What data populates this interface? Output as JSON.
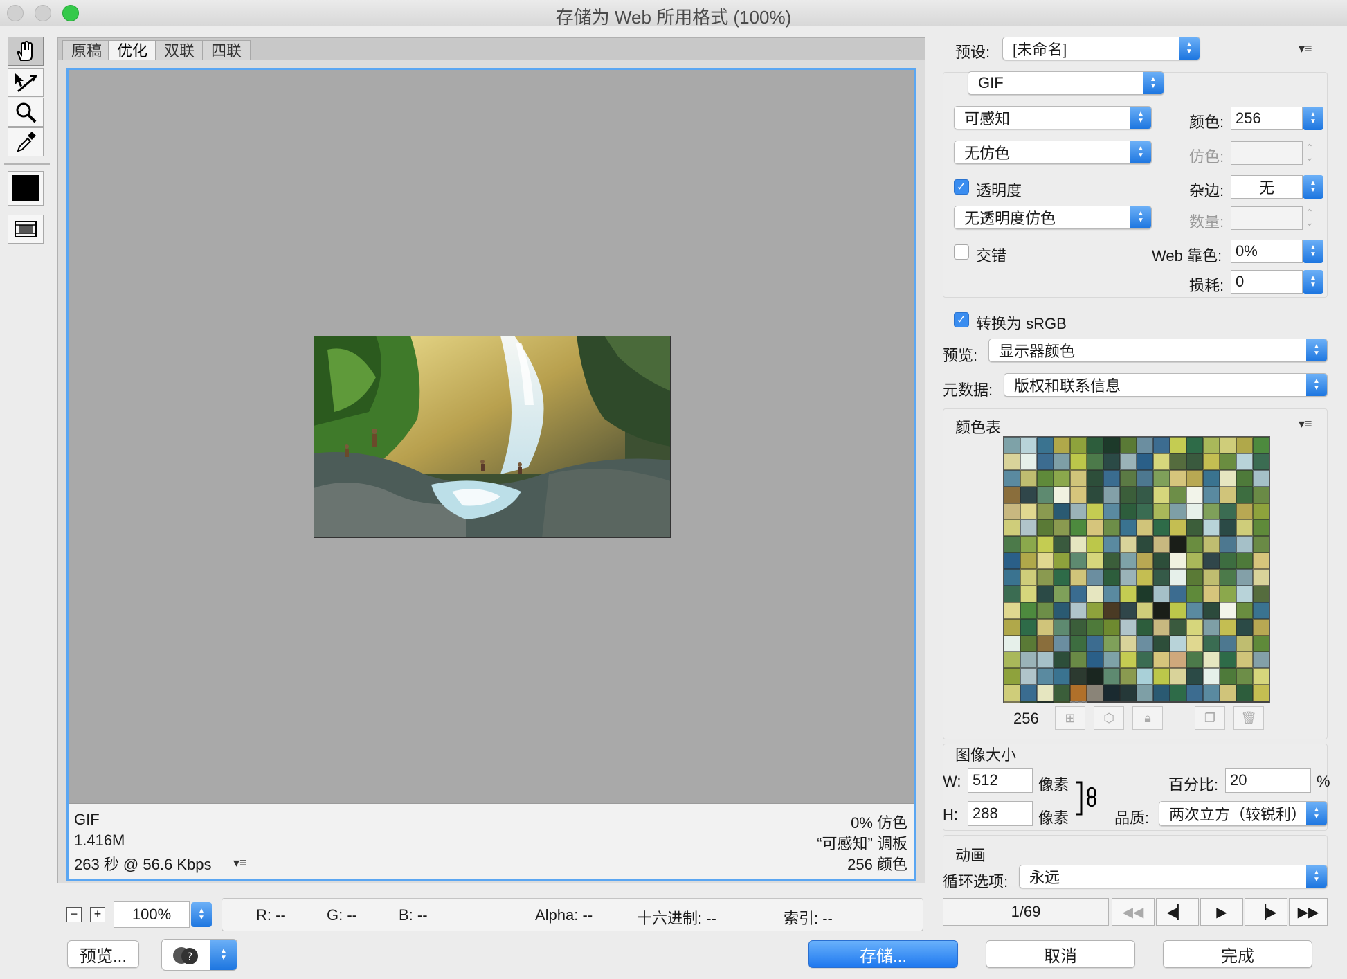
{
  "window": {
    "title": "存储为 Web 所用格式 (100%)"
  },
  "tabs": [
    "原稿",
    "优化",
    "双联",
    "四联"
  ],
  "active_tab": "优化",
  "preview_info": {
    "format": "GIF",
    "size": "1.416M",
    "time": "263 秒 @ 56.6 Kbps",
    "dither": "0% 仿色",
    "palette": "“可感知” 调板",
    "colors": "256 颜色"
  },
  "statusbar": {
    "zoom": "100%",
    "r": "R: --",
    "g": "G: --",
    "b": "B: --",
    "alpha": "Alpha: --",
    "hex": "十六进制: --",
    "index": "索引: --"
  },
  "buttons": {
    "preview": "预览...",
    "save": "存储...",
    "cancel": "取消",
    "done": "完成"
  },
  "settings": {
    "preset_label": "预设:",
    "preset_value": "[未命名]",
    "format": "GIF",
    "reduction": "可感知",
    "dither_algo": "无仿色",
    "colors_label": "颜色:",
    "colors_value": "256",
    "dither_label": "仿色:",
    "transparency_label": "透明度",
    "transparency_checked": true,
    "matte_label": "杂边:",
    "matte_value": "无",
    "transparency_dither": "无透明度仿色",
    "amount_label": "数量:",
    "interlaced_label": "交错",
    "interlaced_checked": false,
    "web_snap_label": "Web 靠色:",
    "web_snap_value": "0%",
    "lossy_label": "损耗:",
    "lossy_value": "0",
    "srgb_label": "转换为 sRGB",
    "srgb_checked": true,
    "preview_label": "预览:",
    "preview_value": "显示器颜色",
    "metadata_label": "元数据:",
    "metadata_value": "版权和联系信息"
  },
  "color_table": {
    "title": "颜色表",
    "count": "256",
    "colors": [
      "#7ea2a8",
      "#b8d3d9",
      "#3a7390",
      "#b0a84a",
      "#8ea23c",
      "#2d5d3c",
      "#1d3a2a",
      "#5a7a36",
      "#6b8ea0",
      "#3c6c90",
      "#c4cc52",
      "#2e6b48",
      "#a9b85a",
      "#cfcd7a",
      "#b0a84a",
      "#4d8a3e",
      "#d9d39a",
      "#e6f0ea",
      "#3c6c90",
      "#7e9fa6",
      "#bcc74a",
      "#4c7a4a",
      "#2b4a46",
      "#9ab3b8",
      "#2a5f88",
      "#d6d67c",
      "#556c3e",
      "#3a5a3e",
      "#c4be52",
      "#6a8d40",
      "#b8d3d9",
      "#3b6c52",
      "#5a8aa0",
      "#bfbd70",
      "#5f8a3a",
      "#8ba84c",
      "#d0c47a",
      "#2d4e3a",
      "#3a6c90",
      "#5b7a44",
      "#4d7890",
      "#7fa05a",
      "#d6c57c",
      "#b8a853",
      "#3a7390",
      "#e6e6c0",
      "#4e7a3a",
      "#a5c0c8",
      "#8a6e3c",
      "#30464a",
      "#5e8a70",
      "#f0f2e0",
      "#d6c57c",
      "#2c4a3c",
      "#83a0a8",
      "#3b5e3a",
      "#355a48",
      "#d6d67c",
      "#6d8e48",
      "#f2f4ea",
      "#5a8aa0",
      "#d0c47a",
      "#3d6d40",
      "#6a8a46",
      "#c8b880",
      "#e0d890",
      "#8a9a50",
      "#2a5a72",
      "#9ab3b8",
      "#c4cc52",
      "#5a8aa0",
      "#2d5d3c",
      "#3a6c52",
      "#a9b85a",
      "#7e9fa6",
      "#e6f0ea",
      "#7fa05a",
      "#3b6c52",
      "#b8a853",
      "#8ea23c",
      "#cfcd7a",
      "#b0c4ca",
      "#5a7a36",
      "#8a9a50",
      "#4d8a3e",
      "#d6c57c",
      "#6d8e48",
      "#3a7390",
      "#d0c47a",
      "#2e6b48",
      "#c4be52",
      "#3c5e3a",
      "#b8d3d9",
      "#2b4a46",
      "#cfcd7a",
      "#5f8a3a",
      "#4c7a4a",
      "#8ba84c",
      "#c4cc52",
      "#3a5a3e",
      "#e6e6c0",
      "#bcc74a",
      "#5a8aa0",
      "#d9d39a",
      "#2c4a3c",
      "#c8b880",
      "#1a1e18",
      "#6a8d40",
      "#bfbd70",
      "#4d7890",
      "#a5c0c8",
      "#6a8a46",
      "#2a5f88",
      "#b0a84a",
      "#e0d890",
      "#8ea23c",
      "#5e8a70",
      "#d6d67c",
      "#3b5e3a",
      "#7ea2a8",
      "#b8a853",
      "#2d4e3a",
      "#f0f2e0",
      "#a9b85a",
      "#30464a",
      "#3d6d40",
      "#4e7a3a",
      "#d6c57c",
      "#3a7390",
      "#cfcd7a",
      "#8a9a50",
      "#2e6b48",
      "#d0c47a",
      "#6b8ea0",
      "#2d5d3c",
      "#9ab3b8",
      "#c4be52",
      "#355a48",
      "#e6f0ea",
      "#5a7a36",
      "#bfbd70",
      "#4c7a4a",
      "#83a0a8",
      "#d9d39a",
      "#3b6c52",
      "#d6d67c",
      "#2b4a46",
      "#7fa05a",
      "#3a6c90",
      "#e6e6c0",
      "#5a8aa0",
      "#c4cc52",
      "#1d3a2a",
      "#a5c0c8",
      "#3c6c90",
      "#5f8a3a",
      "#d6c57c",
      "#8ba84c",
      "#b8d3d9",
      "#556c3e",
      "#e0d890",
      "#4d8a3e",
      "#6d8e48",
      "#2a5a72",
      "#b0c4ca",
      "#8ea23c",
      "#4a3a24",
      "#30464a",
      "#cfcd7a",
      "#1a1e18",
      "#bcc74a",
      "#5a8aa0",
      "#2c4a3c",
      "#f2f4ea",
      "#6a8d40",
      "#3a7390",
      "#b0a84a",
      "#2e6b48",
      "#d0c47a",
      "#5e8a70",
      "#3b5e3a",
      "#4e7a3a",
      "#6e8a30",
      "#b0c4ca",
      "#2d5d3c",
      "#c8b880",
      "#3a5a3e",
      "#d6d67c",
      "#7e9fa6",
      "#c4be52",
      "#2b4a46",
      "#b8a853",
      "#e6f0ea",
      "#5a7a36",
      "#8a6e3c",
      "#6b8ea0",
      "#3d6d40",
      "#3c6c90",
      "#7fa05a",
      "#d9d39a",
      "#6b8ea0",
      "#2d4e3a",
      "#b8d3d9",
      "#e0d890",
      "#3a6c52",
      "#4d7890",
      "#bfbd70",
      "#5f8a3a",
      "#a9b85a",
      "#9ab3b8",
      "#a5c0c8",
      "#2d4e3a",
      "#6a8a46",
      "#2a5f88",
      "#7ea2a8",
      "#c4cc52",
      "#3b6c52",
      "#d6c57c",
      "#cfa87c",
      "#4c7a4a",
      "#e6e6c0",
      "#2e6b48",
      "#d0c47a",
      "#83a0a8",
      "#8ea23c",
      "#b0c4ca",
      "#5a8aa0",
      "#3a7390",
      "#2c3a30",
      "#1a2620",
      "#5e8a70",
      "#8a9a50",
      "#a9d0d8",
      "#bcc74a",
      "#d9d39a",
      "#2b4a46",
      "#e6f0ea",
      "#4e7a3a",
      "#6d8e48",
      "#d6d67c",
      "#cfcd7a",
      "#3a6c90",
      "#e6e6c0",
      "#3b5e3a",
      "#b0702a",
      "#8a8478",
      "#1a2a30",
      "#253838",
      "#7e9fa6",
      "#2a5a72",
      "#2e6b48",
      "#3c6c90",
      "#5a8aa0",
      "#d0c47a",
      "#2d5d3c",
      "#c4be52",
      "#e0d890",
      "#3d6d40",
      "#1d3a2a",
      "#5a7a36",
      "#ffffff"
    ]
  },
  "image_size": {
    "title": "图像大小",
    "w_label": "W:",
    "w_value": "512",
    "h_label": "H:",
    "h_value": "288",
    "unit": "像素",
    "percent_label": "百分比:",
    "percent_value": "20",
    "percent_sign": "%",
    "quality_label": "品质:",
    "quality_value": "两次立方（较锐利）"
  },
  "animation": {
    "title": "动画",
    "loop_label": "循环选项:",
    "loop_value": "永远",
    "frame": "1/69"
  }
}
